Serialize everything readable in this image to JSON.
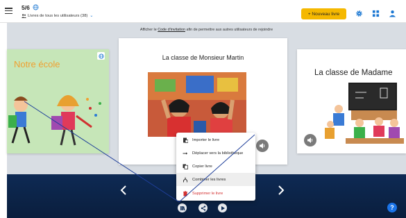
{
  "header": {
    "page_count": "5/6",
    "library_label": "Livres de tous les utilisateurs (38)",
    "new_book_label": "+ Nouveau livre"
  },
  "invite": {
    "prefix": "Afficher le ",
    "link_text": "Code d'invitation",
    "suffix": " afin de permettre aux autres utilisateurs de rejoindre"
  },
  "cards": {
    "left_title": "Notre école",
    "center_title": "La classe de Monsieur Martin",
    "right_title": "La classe de Madame"
  },
  "menu": {
    "items": [
      {
        "label": "Importer le livre",
        "icon": "import-icon"
      },
      {
        "label": "Déplacer vers la bibliothèque",
        "icon": "arrow-right-icon"
      },
      {
        "label": "Copier livre",
        "icon": "copy-icon"
      },
      {
        "label": "Combiner les livres",
        "icon": "merge-icon"
      },
      {
        "label": "Supprimer le livre",
        "icon": "trash-icon"
      }
    ]
  },
  "bottom": {
    "help_label": "?"
  },
  "colors": {
    "accent": "#f5b800",
    "primary": "#1976d2",
    "danger": "#d32f2f",
    "bottom_band": "#0e2a54"
  }
}
